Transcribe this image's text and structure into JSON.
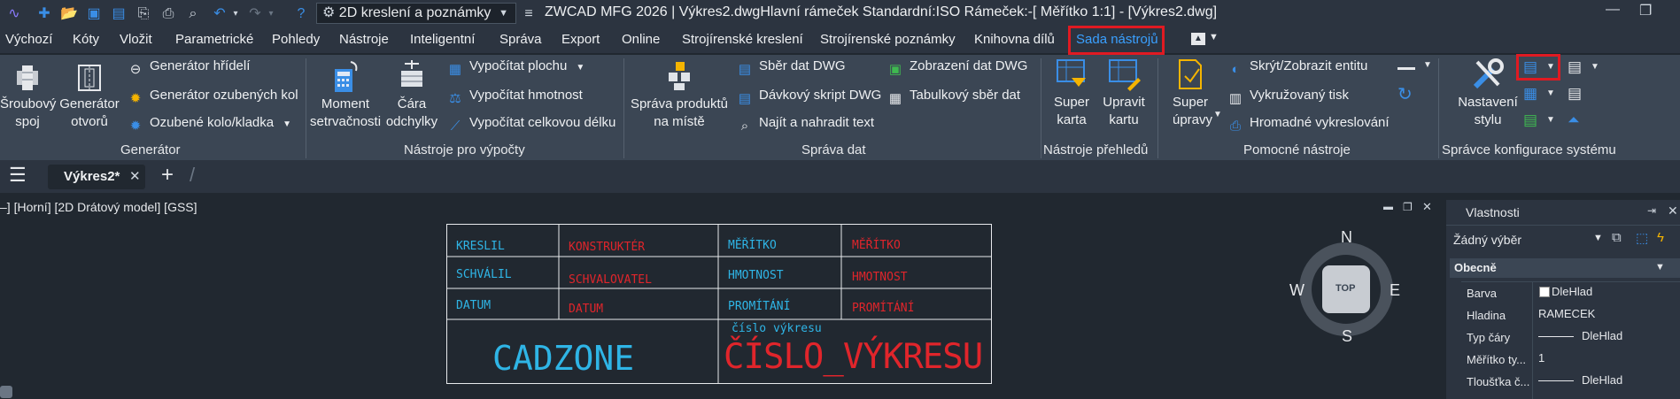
{
  "window": {
    "title": "ZWCAD MFG 2026 | Výkres2.dwgHlavní rámeček  Standardní:ISO Rámeček:-[ Měřítko 1:1] - [Výkres2.dwg]",
    "workspace": "2D kreslení a poznámky"
  },
  "menu_tabs": [
    "Výchozí",
    "Kóty",
    "Vložit",
    "Parametrické",
    "Pohledy",
    "Nástroje",
    "Inteligentní",
    "Správa",
    "Export",
    "Online",
    "Strojírenské kreslení",
    "Strojírenské poznámky",
    "Knihovna dílů",
    "Sada nástrojů"
  ],
  "active_tab": "Sada nástrojů",
  "ribbon": {
    "generator": {
      "label": "Generátor",
      "screw": "Šroubový spoj",
      "hole": "Generátor otvorů",
      "shaft": "Generátor hřídelí",
      "gear": "Generátor ozubených kol",
      "gearwheel": "Ozubené kolo/kladka"
    },
    "calc": {
      "label": "Nástroje pro výpočty",
      "moment": "Moment setrvačnosti",
      "deviation": "Čára odchylky",
      "area": "Vypočítat plochu",
      "mass": "Vypočítat hmotnost",
      "length": "Vypočítat celkovou délku"
    },
    "data": {
      "label": "Správa dat",
      "products": "Správa produktů na místě",
      "collect": "Sběr dat DWG",
      "batch": "Dávkový skript DWG",
      "find": "Najít a nahradit text",
      "display": "Zobrazení dat DWG",
      "table": "Tabulkový sběr dat"
    },
    "overview": {
      "label": "Nástroje přehledů",
      "super_card": "Super karta",
      "edit_card": "Upravit kartu"
    },
    "helper": {
      "label": "Pomocné nástroje",
      "super_edit": "Super úpravy",
      "show_hide": "Skrýt/Zobrazit entitu",
      "hatch_print": "Vykružovaný tisk",
      "batch_plot": "Hromadné vykreslování"
    },
    "config": {
      "label": "Správce konfigurace systému",
      "settings": "Nastavení stylu"
    }
  },
  "file_tab": "Výkres2*",
  "viewport_label": "–] [Horní] [2D Drátový model] [GSS]",
  "title_block": {
    "r1": [
      "KRESLIL",
      "KONSTRUKTÉR",
      "MĚŘÍTKO",
      "MĚŘÍTKO"
    ],
    "r2": [
      "SCHVÁLIL",
      "SCHVALOVATEL",
      "HMOTNOST",
      "HMOTNOST"
    ],
    "r3": [
      "DATUM",
      "DATUM",
      "PROMÍTÁNÍ",
      "PROMÍTÁNÍ"
    ],
    "company": "CADZONE",
    "drawing_no_label": "číslo výkresu",
    "drawing_no": "ČÍSLO_VÝKRESU"
  },
  "viewcube": {
    "n": "N",
    "s": "S",
    "e": "E",
    "w": "W",
    "top": "TOP"
  },
  "properties": {
    "title": "Vlastnosti",
    "selection": "Žádný výběr",
    "section": "Obecně",
    "rows": [
      {
        "name": "Barva",
        "value": "DleHlad"
      },
      {
        "name": "Hladina",
        "value": "RAMECEK"
      },
      {
        "name": "Typ čáry",
        "value": "DleHlad"
      },
      {
        "name": "Měřítko ty...",
        "value": "1"
      },
      {
        "name": "Tloušťka č...",
        "value": "DleHlad"
      }
    ]
  },
  "colors": {
    "accent": "#3aa0ff",
    "highlight": "#e01a22",
    "cad_cyan": "#2fb5e6",
    "cad_red": "#e0252b"
  }
}
